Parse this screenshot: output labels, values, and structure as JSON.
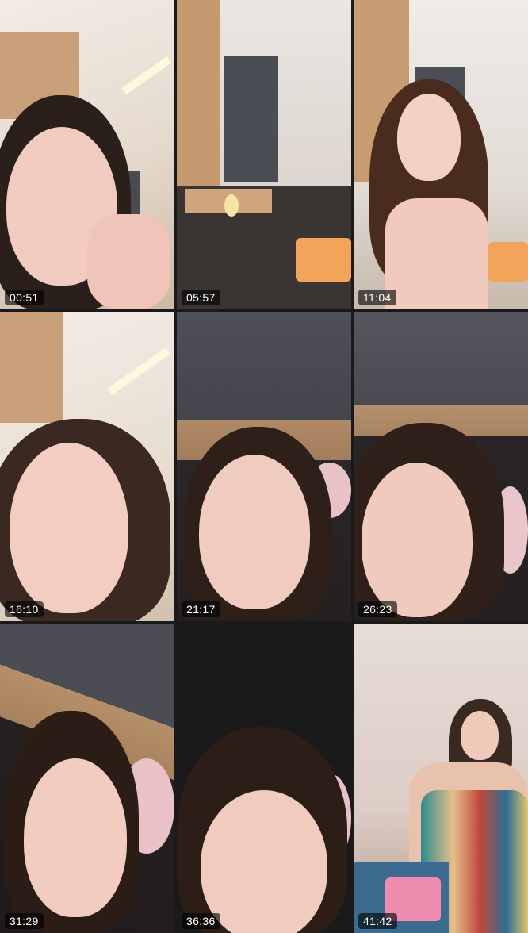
{
  "grid": {
    "columns": 3,
    "rows": 3,
    "tiles": [
      {
        "duration": "00:51",
        "scene": "selfie-closeup-bright-wall"
      },
      {
        "duration": "05:57",
        "scene": "room-desk-curtain"
      },
      {
        "duration": "11:04",
        "scene": "wide-shot-long-hair"
      },
      {
        "duration": "16:10",
        "scene": "selfie-closeup-light"
      },
      {
        "duration": "21:17",
        "scene": "selfie-closeup-dark-curtain"
      },
      {
        "duration": "26:23",
        "scene": "selfie-closeup-dark-curtain"
      },
      {
        "duration": "31:29",
        "scene": "selfie-tilted-headboard"
      },
      {
        "duration": "36:36",
        "scene": "selfie-tilted-headboard"
      },
      {
        "duration": "41:42",
        "scene": "seated-wide-shot"
      }
    ]
  },
  "colors": {
    "background": "#1a1a1a",
    "badge_bg": "rgba(0,0,0,0.62)",
    "badge_text": "#ffffff"
  }
}
